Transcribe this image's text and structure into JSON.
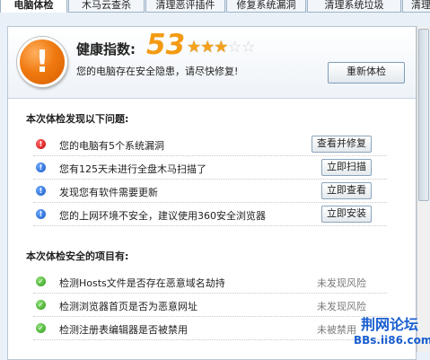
{
  "tabs": [
    "电脑体检",
    "木马云查杀",
    "清理恶评插件",
    "修复系统漏洞",
    "清理系统垃圾",
    "清理"
  ],
  "header": {
    "health_label": "健康指数:",
    "score": "53",
    "stars_total": 5,
    "stars_filled": 3,
    "message": "您的电脑存在安全隐患，请尽快修复!",
    "recheck_button": "重新体检"
  },
  "issues": {
    "title": "本次体检发现以下问题:",
    "items": [
      {
        "severity": "red",
        "text": "您的电脑有5个系统漏洞",
        "action": "查看并修复"
      },
      {
        "severity": "blue",
        "text": "您有125天未进行全盘木马扫描了",
        "action": "立即扫描"
      },
      {
        "severity": "blue",
        "text": "发现您有软件需要更新",
        "action": "立即查看"
      },
      {
        "severity": "blue",
        "text": "您的上网环境不安全，建议使用360安全浏览器",
        "action": "立即安装"
      }
    ]
  },
  "safe": {
    "title": "本次体检安全的项目有:",
    "items": [
      {
        "text": "检测Hosts文件是否存在恶意域名劫持",
        "status": "未发现风险"
      },
      {
        "text": "检测浏览器首页是否为恶意网址",
        "status": "未发现风险"
      },
      {
        "text": "检测注册表编辑器是否被禁用",
        "status": "未被禁用"
      }
    ]
  },
  "watermark": {
    "title": "荆网论坛",
    "url": "BBs.ii86.com"
  },
  "colors": {
    "score": "#f49a12",
    "star_on": "#f3a21b",
    "warning_orange": "#f07a10",
    "issue_red": "#c80000",
    "issue_blue": "#1556c4",
    "safe_green": "#2c9a12"
  }
}
